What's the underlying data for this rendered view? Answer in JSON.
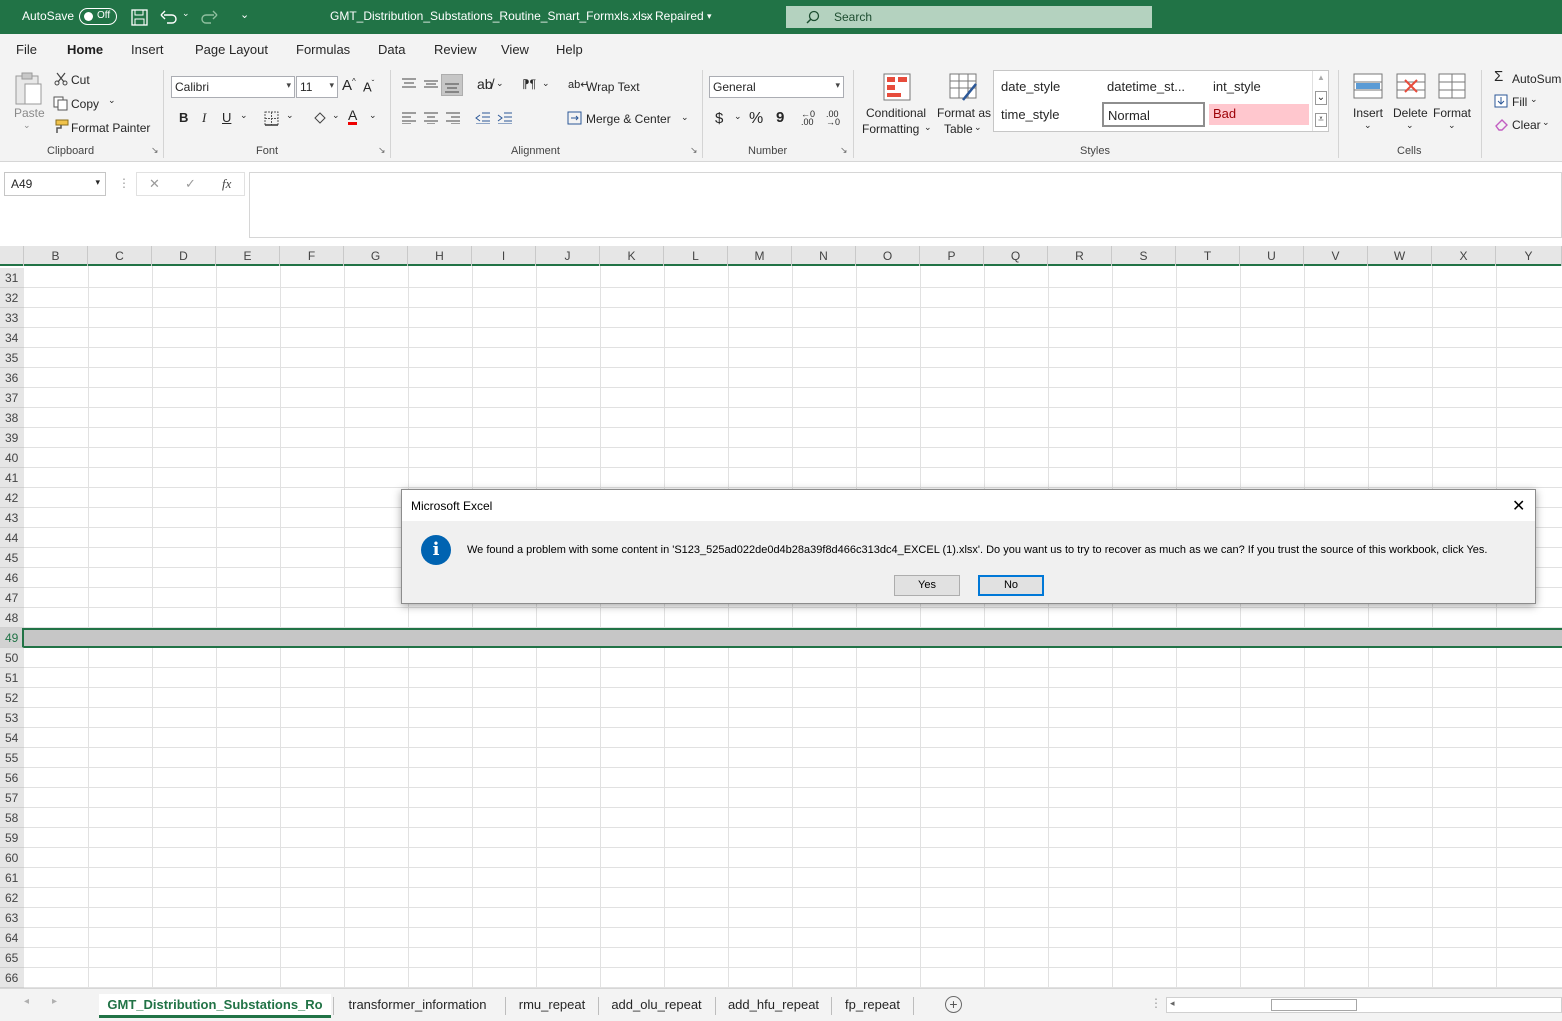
{
  "titlebar": {
    "autosave_label": "AutoSave",
    "autosave_state": "Off",
    "filename": "GMT_Distribution_Substations_Routine_Smart_Formxls.xlsx",
    "separator": "-",
    "status": "Repaired",
    "search_placeholder": "Search"
  },
  "menu_tabs": [
    "File",
    "Home",
    "Insert",
    "Page Layout",
    "Formulas",
    "Data",
    "Review",
    "View",
    "Help"
  ],
  "ribbon": {
    "clipboard": {
      "paste": "Paste",
      "cut": "Cut",
      "copy": "Copy",
      "format_painter": "Format Painter",
      "label": "Clipboard"
    },
    "font": {
      "name": "Calibri",
      "size": "11",
      "bold": "B",
      "italic": "I",
      "underline": "U",
      "label": "Font"
    },
    "alignment": {
      "wrap_text": "Wrap Text",
      "merge_center": "Merge & Center",
      "label": "Alignment"
    },
    "number": {
      "format": "General",
      "currency": "$",
      "percent": "%",
      "comma": "9",
      "label": "Number"
    },
    "styles": {
      "conditional_1": "Conditional",
      "conditional_2": "Formatting",
      "format_table_1": "Format as",
      "format_table_2": "Table",
      "gallery": [
        "date_style",
        "datetime_st...",
        "int_style",
        "time_style",
        "Normal",
        "Bad"
      ],
      "label": "Styles"
    },
    "cells": {
      "insert": "Insert",
      "delete": "Delete",
      "format": "Format",
      "label": "Cells"
    },
    "editing": {
      "autosum": "AutoSum",
      "fill": "Fill",
      "clear": "Clear"
    }
  },
  "formula_bar": {
    "name_box": "A49",
    "fx": "fx",
    "cancel": "✕",
    "enter": "✓"
  },
  "columns": [
    "B",
    "C",
    "D",
    "E",
    "F",
    "G",
    "H",
    "I",
    "J",
    "K",
    "L",
    "M",
    "N",
    "O",
    "P",
    "Q",
    "R",
    "S",
    "T",
    "U",
    "V",
    "W",
    "X",
    "Y"
  ],
  "rows": [
    "31",
    "32",
    "33",
    "34",
    "35",
    "36",
    "37",
    "38",
    "39",
    "40",
    "41",
    "42",
    "43",
    "44",
    "45",
    "46",
    "47",
    "48",
    "49",
    "50",
    "51",
    "52",
    "53",
    "54",
    "55",
    "56",
    "57",
    "58",
    "59",
    "60",
    "61",
    "62",
    "63",
    "64",
    "65",
    "66"
  ],
  "selected_row": "49",
  "dialog": {
    "title": "Microsoft Excel",
    "message": "We found a problem with some content in 'S123_525ad022de0d4b28a39f8d466c313dc4_EXCEL (1).xlsx'. Do you want us to try to recover as much as we can? If you trust the source of this workbook, click Yes.",
    "yes": "Yes",
    "no": "No"
  },
  "sheet_tabs": [
    "GMT_Distribution_Substations_Ro",
    "transformer_information",
    "rmu_repeat",
    "add_olu_repeat",
    "add_hfu_repeat",
    "fp_repeat"
  ],
  "colors": {
    "accent": "#217346",
    "dialog_icon": "#0063b1",
    "bad_style": "#ffc7ce"
  }
}
